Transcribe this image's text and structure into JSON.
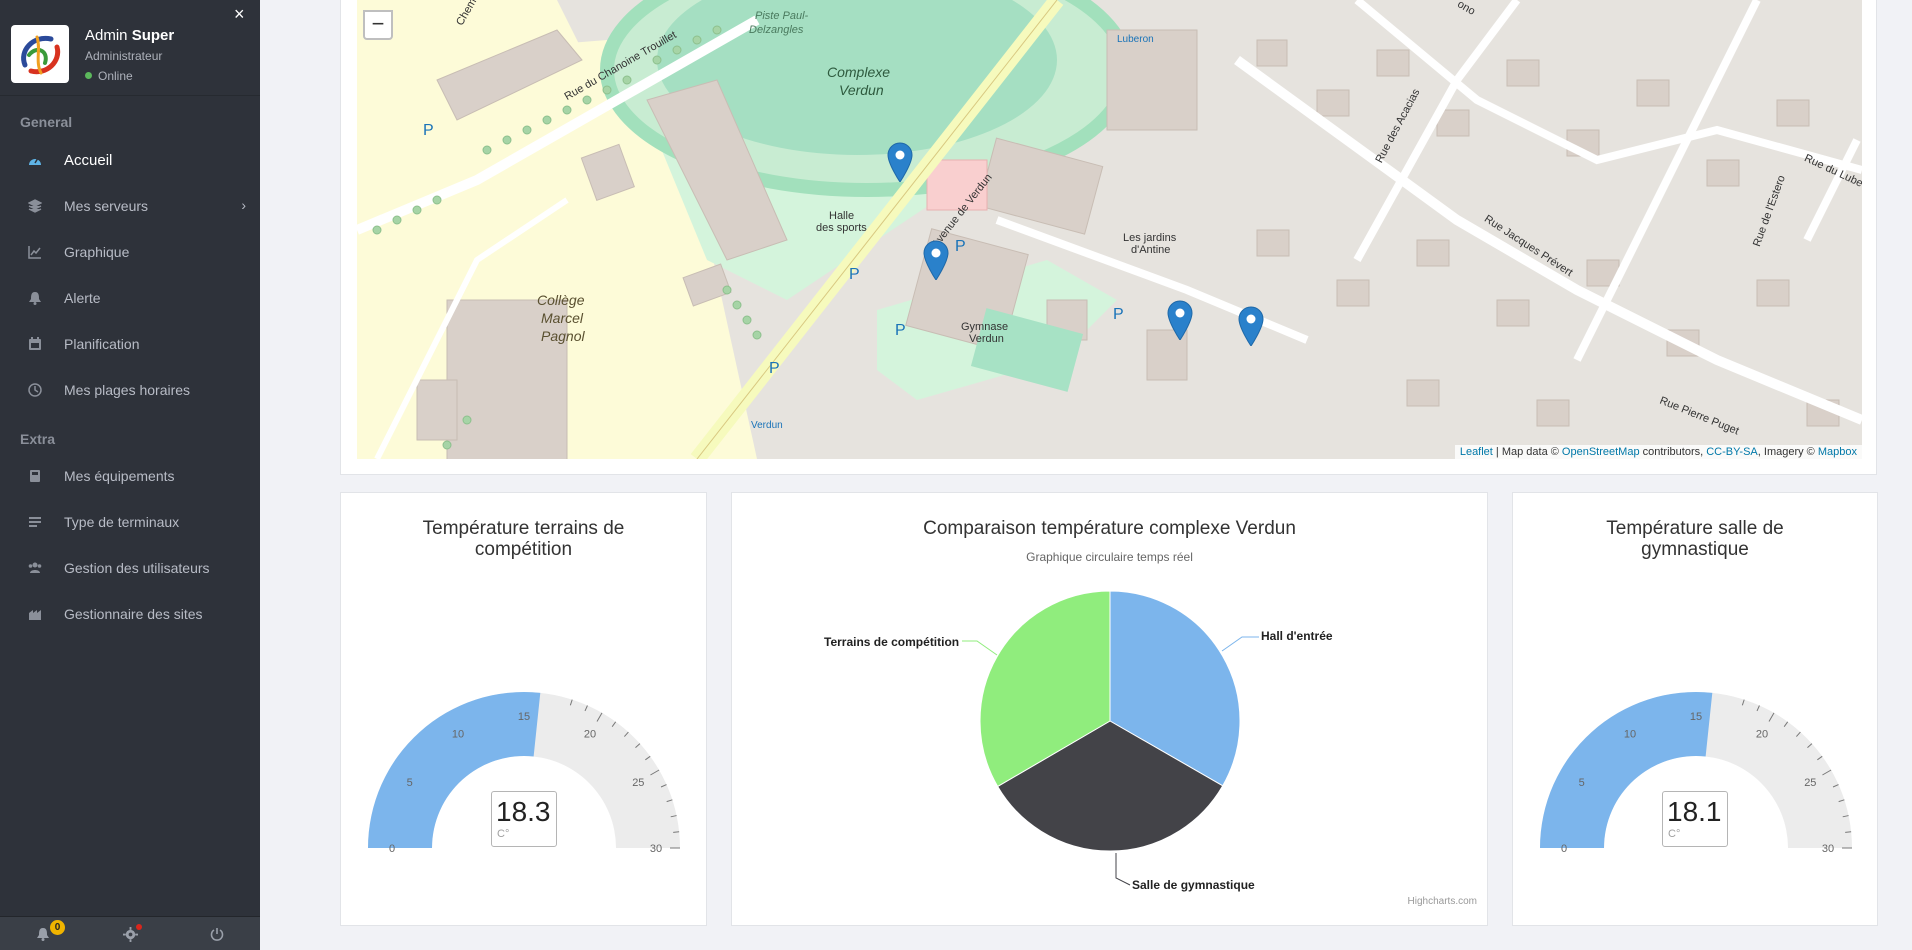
{
  "sidebar": {
    "user": {
      "first": "Admin",
      "last": "Super",
      "role": "Administrateur",
      "status": "Online"
    },
    "close_symbol": "×",
    "sections": [
      {
        "title": "General"
      },
      {
        "title": "Extra"
      }
    ],
    "items": [
      {
        "label": "Accueil",
        "icon": "dashboard-icon"
      },
      {
        "label": "Mes serveurs",
        "icon": "layers-icon"
      },
      {
        "label": "Graphique",
        "icon": "line-chart-icon"
      },
      {
        "label": "Alerte",
        "icon": "bell-icon"
      },
      {
        "label": "Planification",
        "icon": "calendar-icon"
      },
      {
        "label": "Mes plages horaires",
        "icon": "clock-icon"
      },
      {
        "label": "Mes équipements",
        "icon": "equipment-icon"
      },
      {
        "label": "Type de terminaux",
        "icon": "list-icon"
      },
      {
        "label": "Gestion des utilisateurs",
        "icon": "users-icon"
      },
      {
        "label": "Gestionnaire des sites",
        "icon": "sitemap-icon"
      }
    ],
    "notifications_count": "0"
  },
  "map": {
    "zoom_out": "−",
    "attribution": {
      "leaflet": "Leaflet",
      "text1": " | Map data © ",
      "osm": "OpenStreetMap",
      "text2": " contributors, ",
      "license": "CC-BY-SA",
      "text3": ", Imagery © ",
      "mapbox": "Mapbox"
    },
    "labels": {
      "complexe": "Complexe",
      "verdun": "Verdun",
      "piste1": "Piste Paul-",
      "piste2": "Delzangles",
      "luberon": "Luberon",
      "halle1": "Halle",
      "halle2": "des sports",
      "jardins1": "Les jardins",
      "jardins2": "d'Antine",
      "gymnase1": "Gymnase",
      "gymnase2": "Verdun",
      "college1": "Collège",
      "college2": "Marcel",
      "college3": "Pagnol",
      "verdun_stop": "Verdun",
      "rue_chanoine": "Rue du Chanoine Trouillet",
      "avenue_verdun": "Avenue de Verdun",
      "rue_acacias": "Rue des Acacias",
      "rue_prevert": "Rue Jacques Prévert",
      "rue_puget": "Rue Pierre Puget",
      "rue_lube": "Rue du Lube",
      "rue_estero": "Rue de l'Estero",
      "chem": "Chem",
      "ono": "ono",
      "parking": "P"
    }
  },
  "gauge_left": {
    "title": "Température terrains de compétition",
    "value": "18.3",
    "unit": "C°",
    "min": 0,
    "max": 30,
    "band_end": 16,
    "ticks": [
      "0",
      "5",
      "10",
      "15",
      "20",
      "25",
      "30"
    ]
  },
  "pie": {
    "title": "Comparaison température complexe Verdun",
    "subtitle": "Graphique circulaire temps réel",
    "credits": "Highcharts.com"
  },
  "gauge_right": {
    "title": "Température salle de gymnastique",
    "value": "18.1",
    "unit": "C°",
    "min": 0,
    "max": 30,
    "band_end": 16,
    "ticks": [
      "0",
      "5",
      "10",
      "15",
      "20",
      "25",
      "30"
    ]
  },
  "chart_data": {
    "type": "pie",
    "title": "Comparaison température complexe Verdun",
    "subtitle": "Graphique circulaire temps réel",
    "categories": [
      "Hall d'entrée",
      "Salle de gymnastique",
      "Terrains de compétition"
    ],
    "values": [
      33.3,
      33.3,
      33.4
    ],
    "colors": [
      "#7cb5ec",
      "#434348",
      "#90ed7d"
    ]
  }
}
